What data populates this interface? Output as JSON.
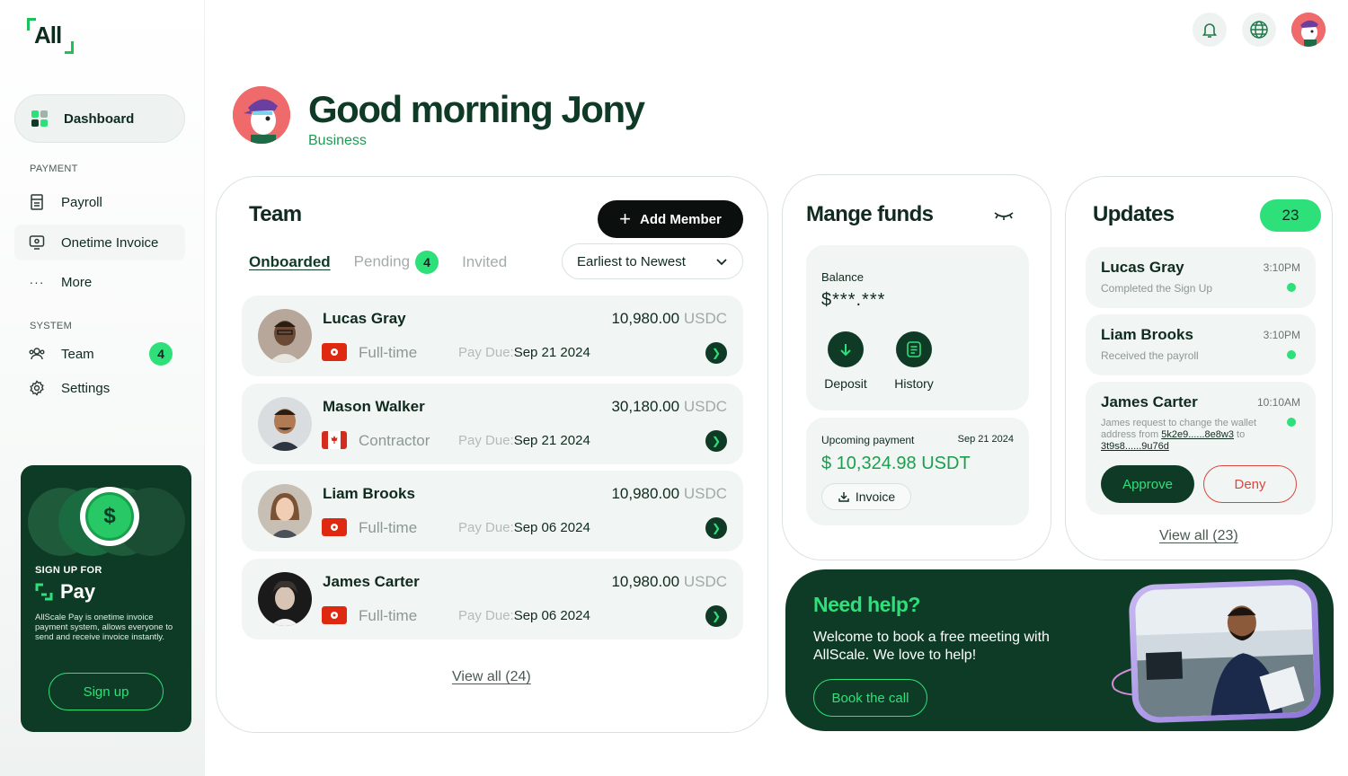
{
  "brand": {
    "logo_text": "All"
  },
  "sidebar": {
    "dashboard_label": "Dashboard",
    "payment_section": "PAYMENT",
    "payroll": "Payroll",
    "onetime_invoice": "Onetime Invoice",
    "more": "More",
    "system_section": "SYSTEM",
    "team": "Team",
    "team_badge": "4",
    "settings": "Settings"
  },
  "promo": {
    "sign_up_for": "SIGN UP FOR",
    "product": "Pay",
    "coin": "$",
    "description": "AllScale Pay is onetime invoice payment system, allows everyone to send and receive invoice instantly.",
    "button": "Sign up"
  },
  "header": {
    "greeting": "Good morning Jony",
    "account_type": "Business"
  },
  "team": {
    "title": "Team",
    "add_member": "Add Member",
    "tabs": {
      "onboarded": "Onboarded",
      "pending": "Pending",
      "pending_count": "4",
      "invited": "Invited"
    },
    "sort": "Earliest to Newest",
    "pay_due_label": "Pay Due:",
    "members": [
      {
        "name": "Lucas Gray",
        "amount": "10,980.00",
        "currency": "USDC",
        "type": "Full-time",
        "due": "Sep 21 2024",
        "flag": "hk"
      },
      {
        "name": "Mason Walker",
        "amount": "30,180.00",
        "currency": "USDC",
        "type": "Contractor",
        "due": "Sep 21 2024",
        "flag": "ca"
      },
      {
        "name": "Liam Brooks",
        "amount": "10,980.00",
        "currency": "USDC",
        "type": "Full-time",
        "due": "Sep 06 2024",
        "flag": "hk"
      },
      {
        "name": "James Carter",
        "amount": "10,980.00",
        "currency": "USDC",
        "type": "Full-time",
        "due": "Sep 06 2024",
        "flag": "hk"
      }
    ],
    "view_all": "View all (24)"
  },
  "funds": {
    "title": "Mange funds",
    "balance_label": "Balance",
    "balance_value": "$***.***",
    "deposit": "Deposit",
    "history": "History",
    "upcoming_label": "Upcoming payment",
    "upcoming_date": "Sep 21 2024",
    "upcoming_amount": "$ 10,324.98 USDT",
    "invoice": "Invoice"
  },
  "updates": {
    "title": "Updates",
    "count": "23",
    "items": [
      {
        "name": "Lucas Gray",
        "time": "3:10PM",
        "status": "Completed the Sign Up"
      },
      {
        "name": "Liam Brooks",
        "time": "3:10PM",
        "status": "Received the payroll"
      },
      {
        "name": "James Carter",
        "time": "10:10AM",
        "text_pre": "James request to change the wallet address from ",
        "from_addr": "5k2e9......8e8w3",
        "text_mid": " to ",
        "to_addr": "3t9s8......9u76d"
      }
    ],
    "approve": "Approve",
    "deny": "Deny",
    "view_all": "View all (23)"
  },
  "help": {
    "title": "Need help?",
    "description": "Welcome to book a free meeting with AllScale. We love to help!",
    "button": "Book the call"
  },
  "colors": {
    "brand_dark": "#0e3b26",
    "accent": "#2ee07a",
    "danger": "#d9473f"
  }
}
